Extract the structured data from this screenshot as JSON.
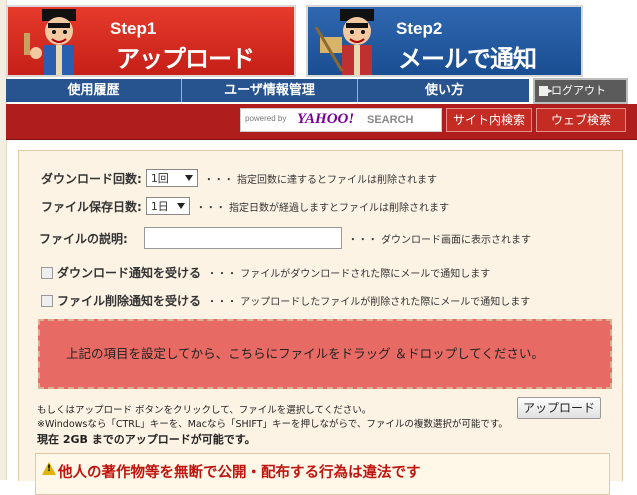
{
  "steps": [
    {
      "label": "Step1",
      "title": "アップロード"
    },
    {
      "label": "Step2",
      "title": "メールで通知"
    }
  ],
  "nav": {
    "tabs": [
      "使用履歴",
      "ユーザ情報管理",
      "使い方"
    ],
    "logout": "ログアウト"
  },
  "search": {
    "powered_by": "powered by",
    "brand": "YAHOO!",
    "search_word": "SEARCH",
    "site_search": "サイト内検索",
    "web_search": "ウェブ検索"
  },
  "form": {
    "download_count": {
      "label": "ダウンロード回数:",
      "value": "1回",
      "note": "・・・ 指定回数に達するとファイルは削除されます"
    },
    "retention_days": {
      "label": "ファイル保存日数:",
      "value": "1日",
      "note": "・・・ 指定日数が経過しますとファイルは削除されます"
    },
    "description": {
      "label": "ファイルの説明:",
      "value": "",
      "note": "・・・ ダウンロード画面に表示されます"
    },
    "notify_download": {
      "label": "ダウンロード通知を受ける",
      "note": "・・・ ファイルがダウンロードされた際にメールで通知します"
    },
    "notify_delete": {
      "label": "ファイル削除通知を受ける",
      "note": "・・・ アップロードしたファイルが削除された際にメールで通知します"
    }
  },
  "dropzone": "上記の項目を設定してから、こちらにファイルをドラッグ ＆ドロップしてください。",
  "info": {
    "line1": "もしくはアップロード ボタンをクリックして、ファイルを選択してください。",
    "line2": "※Windowsなら「CTRL」キーを、Macなら「SHIFT」キーを押しながらで、ファイルの複数選択が可能です。",
    "limit": "現在 2GB までのアップロードが可能です。"
  },
  "upload_button": "アップロード",
  "warning": "他人の著作物等を無断で公開・配布する行為は違法です",
  "colors": {
    "red": "#c51f17",
    "blue": "#1a4e92",
    "nav": "#27538f",
    "panel": "#fdf3e4",
    "drop": "#e76b64",
    "warn_text": "#c0150f"
  }
}
